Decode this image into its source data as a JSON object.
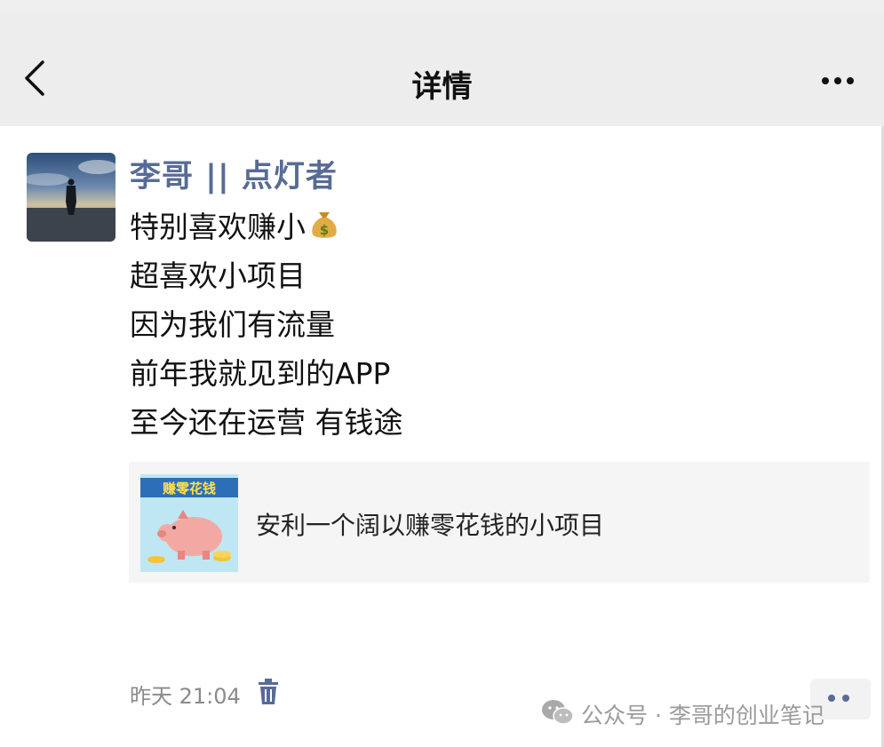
{
  "nav": {
    "title": "详情"
  },
  "post": {
    "author": "李哥 || 点灯者",
    "lines": [
      "特别喜欢赚小",
      "超喜欢小项目",
      "因为我们有流量",
      "前年我就见到的APP",
      "至今还在运营 有钱途"
    ],
    "link_card": {
      "title": "安利一个阔以赚零花钱的小项目",
      "thumb_caption": "赚零花钱"
    },
    "time": "昨天 21:04"
  },
  "watermark": {
    "text": "公众号 · 李哥的创业笔记"
  },
  "colors": {
    "nav_bg": "#ededed",
    "author_link": "#576b95",
    "card_bg": "#f5f5f5",
    "muted_text": "#8a8a8a"
  }
}
